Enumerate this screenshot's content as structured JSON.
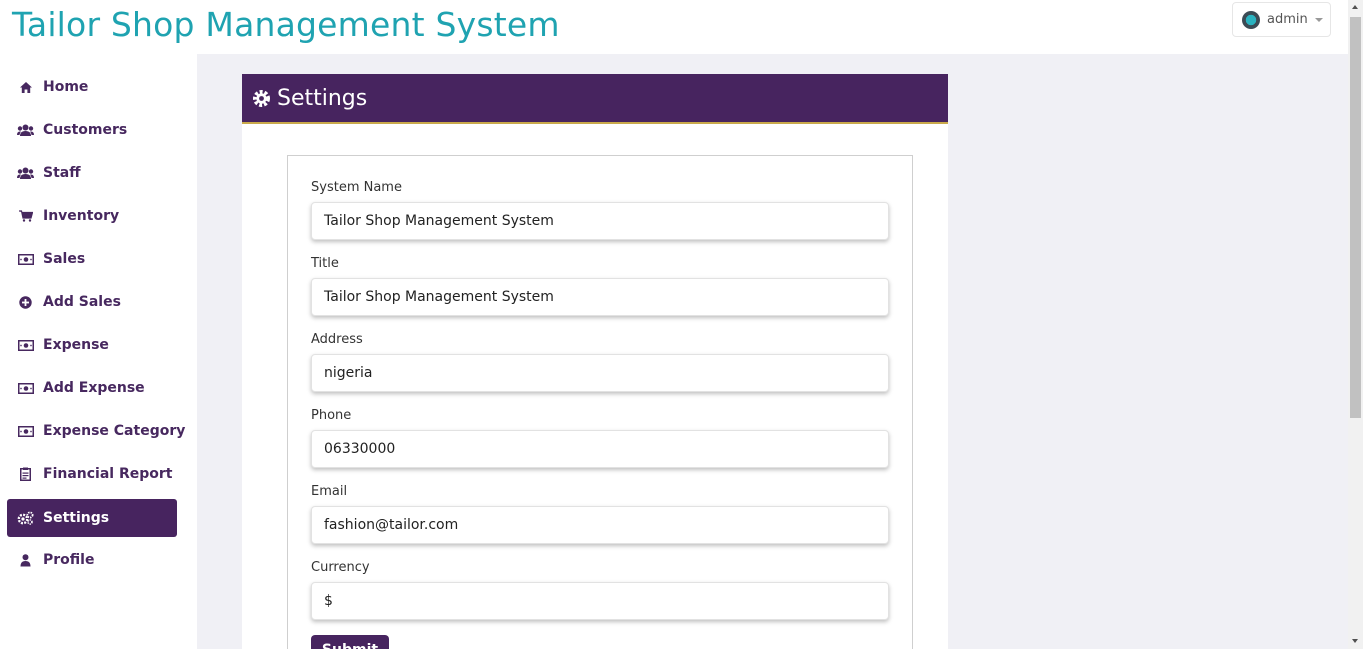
{
  "header": {
    "app_title": "Tailor Shop Management System",
    "user_name": "admin"
  },
  "sidebar": {
    "items": [
      {
        "label": "Home",
        "icon": "home-icon"
      },
      {
        "label": "Customers",
        "icon": "users-icon"
      },
      {
        "label": "Staff",
        "icon": "users-icon"
      },
      {
        "label": "Inventory",
        "icon": "cart-icon"
      },
      {
        "label": "Sales",
        "icon": "money-icon"
      },
      {
        "label": "Add Sales",
        "icon": "plus-circle-icon"
      },
      {
        "label": "Expense",
        "icon": "money-icon"
      },
      {
        "label": "Add Expense",
        "icon": "money-icon"
      },
      {
        "label": "Expense Category",
        "icon": "money-icon"
      },
      {
        "label": "Financial Report",
        "icon": "clipboard-icon"
      },
      {
        "label": "Settings",
        "icon": "cogs-icon",
        "active": true
      },
      {
        "label": "Profile",
        "icon": "user-icon"
      }
    ]
  },
  "panel": {
    "title": "Settings"
  },
  "form": {
    "fields": [
      {
        "label": "System Name",
        "value": "Tailor Shop Management System"
      },
      {
        "label": "Title",
        "value": "Tailor Shop Management System"
      },
      {
        "label": "Address",
        "value": "nigeria"
      },
      {
        "label": "Phone",
        "value": "06330000"
      },
      {
        "label": "Email",
        "value": "fashion@tailor.com"
      },
      {
        "label": "Currency",
        "value": "$"
      }
    ],
    "submit_label": "Submit"
  },
  "colors": {
    "brand_teal": "#1fa3b1",
    "brand_purple": "#47245f",
    "accent_gold": "#c9a94b",
    "content_bg": "#f0f0f5"
  }
}
